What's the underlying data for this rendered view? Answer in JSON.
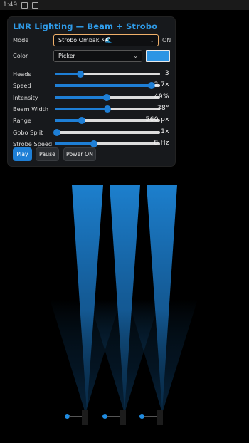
{
  "statusbar": {
    "time": "1:49"
  },
  "panel": {
    "title": "LNR Lighting — Beam + Strobo",
    "mode": {
      "label": "Mode",
      "value": "Strobo Ombak ⚡🌊",
      "state": "ON"
    },
    "color": {
      "label": "Color",
      "value": "Picker",
      "swatch": "#2d95e4"
    },
    "sliders": [
      {
        "label": "Heads",
        "value": "3",
        "level": 0.24
      },
      {
        "label": "Speed",
        "value": "2.7x",
        "level": 0.92
      },
      {
        "label": "Intensity",
        "value": "49%",
        "level": 0.49
      },
      {
        "label": "Beam Width",
        "value": "38°",
        "level": 0.5
      },
      {
        "label": "Range",
        "value": "560 px",
        "level": 0.26
      },
      {
        "label": "Gobo Split",
        "value": "1x",
        "level": 0.02
      },
      {
        "label": "Strobe Speed",
        "value": "8 Hz",
        "level": 0.37
      }
    ],
    "buttons": {
      "play": "Play",
      "pause": "Pause",
      "power": "Power ON"
    }
  },
  "colors": {
    "accent": "#1e7fd6",
    "beam": "#2d95e4",
    "title": "#2f9be8"
  }
}
